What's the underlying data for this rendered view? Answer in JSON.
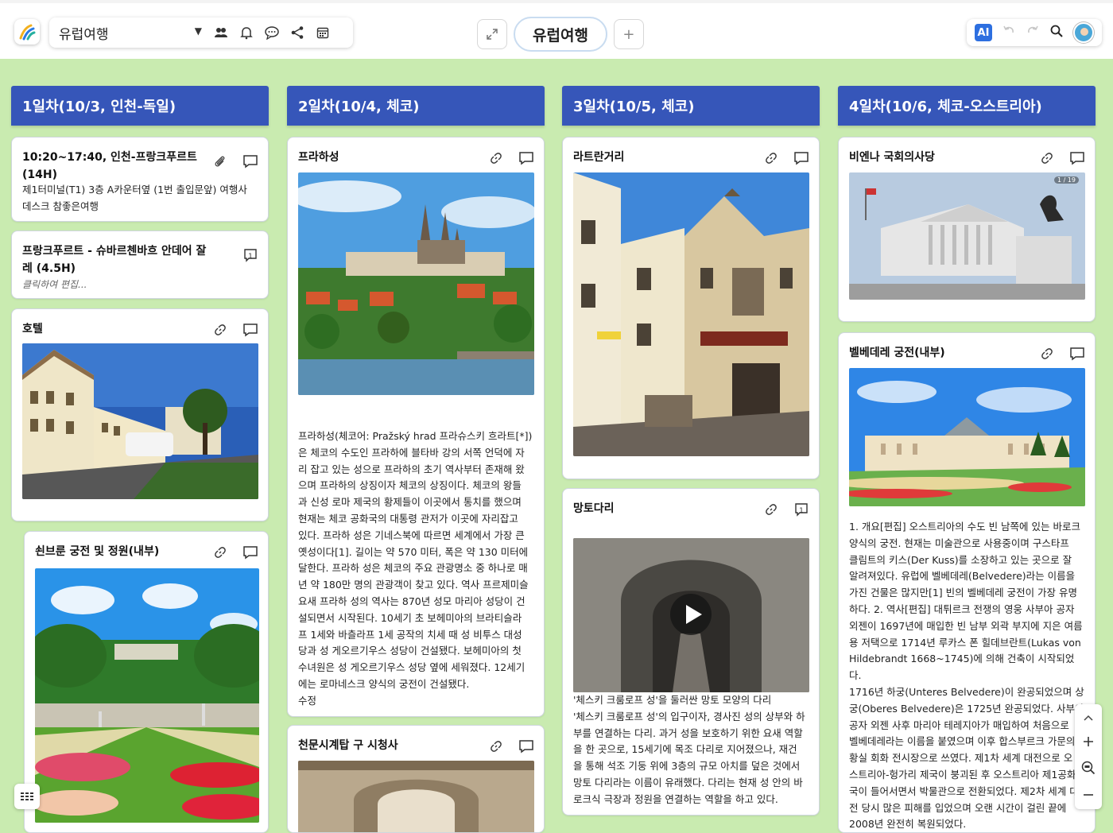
{
  "app": {
    "board_name": "유럽여행",
    "active_tab": "유럽여행",
    "ai_label": "AI"
  },
  "icons": {
    "logo": "logo-icon",
    "caret": "chevron-down-icon",
    "members": "people-icon",
    "bell": "bell-icon",
    "chat": "chat-icon",
    "share": "share-icon",
    "calendar": "calendar-icon",
    "expand": "expand-icon",
    "add_tab": "plus-icon",
    "undo": "undo-icon",
    "redo": "redo-icon",
    "search": "search-icon"
  },
  "columns": [
    {
      "title": "1일차(10/3, 인천-독일)",
      "cards": [
        {
          "title": "10:20~17:40, 인천-프랑크푸르트 (14H)",
          "text": "제1터미널(T1) 3층 A카운터옆 (1번 출입문앞) 여행사 데스크 참좋은여행"
        },
        {
          "title": "프랑크푸르트 - 슈바르첸바흐 안데어 잘레 (4.5H)",
          "hint": "클릭하여 편집...",
          "comment_count": "1"
        },
        {
          "title": "호텔"
        },
        {
          "title": "쇤브룬 궁전 및 정원(내부)"
        }
      ]
    },
    {
      "title": "2일차(10/4, 체코)",
      "cards": [
        {
          "title": "프라하성",
          "text_lines": [
            "프라하성(체코어: Pražský hrad 프라슈스키 흐라트[*])",
            "은 체코의 수도인 프라하에 블타바 강의 서쪽 언덕에 자",
            "리 잡고 있는 성으로 프라하의 초기 역사부터 존재해 왔",
            "으며 프라하의 상징이자 체코의 상징이다. 체코의 왕들",
            "과 신성 로마 제국의 황제들이 이곳에서 통치를 했으며",
            "현재는 체코 공화국의 대통령 관저가 이곳에 자리잡고",
            "있다. 프라하 성은 기네스북에 따르면 세계에서 가장 큰",
            "옛성이다[1]. 길이는 약 570 미터, 폭은 약 130 미터에",
            "달한다. 프라하 성은 체코의 주요 관광명소 중 하나로 매",
            "년 약 180만 명의 관광객이 찾고 있다. 역사 프르제미슬",
            "요새 프라하 성의 역사는 870년 성모 마리아 성당이 건",
            "설되면서 시작된다. 10세기 초 보헤미아의 브라티슬라",
            "프 1세와 바츨라프 1세 공작의 치세 때 성 비투스 대성",
            "당과 성 게오르기우스 성당이 건설됐다. 보헤미아의 첫",
            "수녀원은 성 게오르기우스 성당 옆에 세워졌다. 12세기",
            "에는 로마네스크 양식의 궁전이 건설됐다.",
            "수정"
          ]
        },
        {
          "title": "천문시계탑 구 시청사"
        }
      ]
    },
    {
      "title": "3일차(10/5, 체코)",
      "cards": [
        {
          "title": "라트란거리"
        },
        {
          "title": "망토다리",
          "comment_count": "1",
          "text_lines": [
            "'체스키 크룸로프 성'을 둘러싼 망토 모양의 다리",
            "'체스키 크룸로프 성'의 입구이자, 경사진 성의 상부와 하",
            "부를 연결하는 다리. 과거 성을 보호하기 위한 요새 역할",
            "을 한 곳으로, 15세기에 목조 다리로 지어졌으나, 재건",
            "을 통해 석조 기둥 위에 3층의 규모 아치를 덮은 것에서",
            "망토 다리라는 이름이 유래했다. 다리는 현재 성 안의 바",
            "로크식 극장과 정원을 연결하는 역할을 하고 있다."
          ]
        }
      ]
    },
    {
      "title": "4일차(10/6, 체코-오스트리아)",
      "cards": [
        {
          "title": "비엔나 국회의사당",
          "badge": "1 / 19"
        },
        {
          "title": "벨베데레 궁전(내부)",
          "text_lines": [
            "1. 개요[편집] 오스트리아의 수도 빈 남쪽에 있는 바로크",
            "양식의 궁전. 현재는 미술관으로 사용중이며 구스타프",
            "클림트의 키스(Der Kuss)를 소장하고 있는 곳으로 잘",
            "알려져있다. 유럽에 벨베데레(Belvedere)라는 이름을",
            "가진 건물은 많지만[1] 빈의 벨베데레 궁전이 가장 유명",
            "하다. 2. 역사[편집] 대튀르크 전쟁의 영웅 사부아 공자",
            "외젠이 1697년에 매입한 빈 남부 외곽 부지에 지은 여름",
            "용 저택으로 1714년 루카스 폰 힐데브란트(Lukas von",
            "Hildebrandt 1668~1745)에 의해 건축이 시작되었다.",
            "1716년 하궁(Unteres Belvedere)이 완공되었으며 상",
            "궁(Oberes Belvedere)은 1725년 완공되었다. 사부아",
            "공자 외젠 사후 마리아 테레지아가 매입하여 처음으로",
            "벨베데레라는 이름을 붙였으며 이후 합스부르크 가문의",
            "황실 회화 전시장으로 쓰였다. 제1차 세계 대전으로 오",
            "스트리아-헝가리 제국이 붕괴된 후 오스트리아 제1공화",
            "국이 들어서면서 박물관으로 전환되었다. 제2차 세계 대",
            "전 당시 많은 피해를 입었으며 오랜 시간이 걸린 끝에",
            "2008년 완전히 복원되었다."
          ]
        }
      ]
    }
  ],
  "colors": {
    "board_bg": "#c9ebb0",
    "column_header": "#3656b9",
    "accent": "#2d6fe0"
  }
}
